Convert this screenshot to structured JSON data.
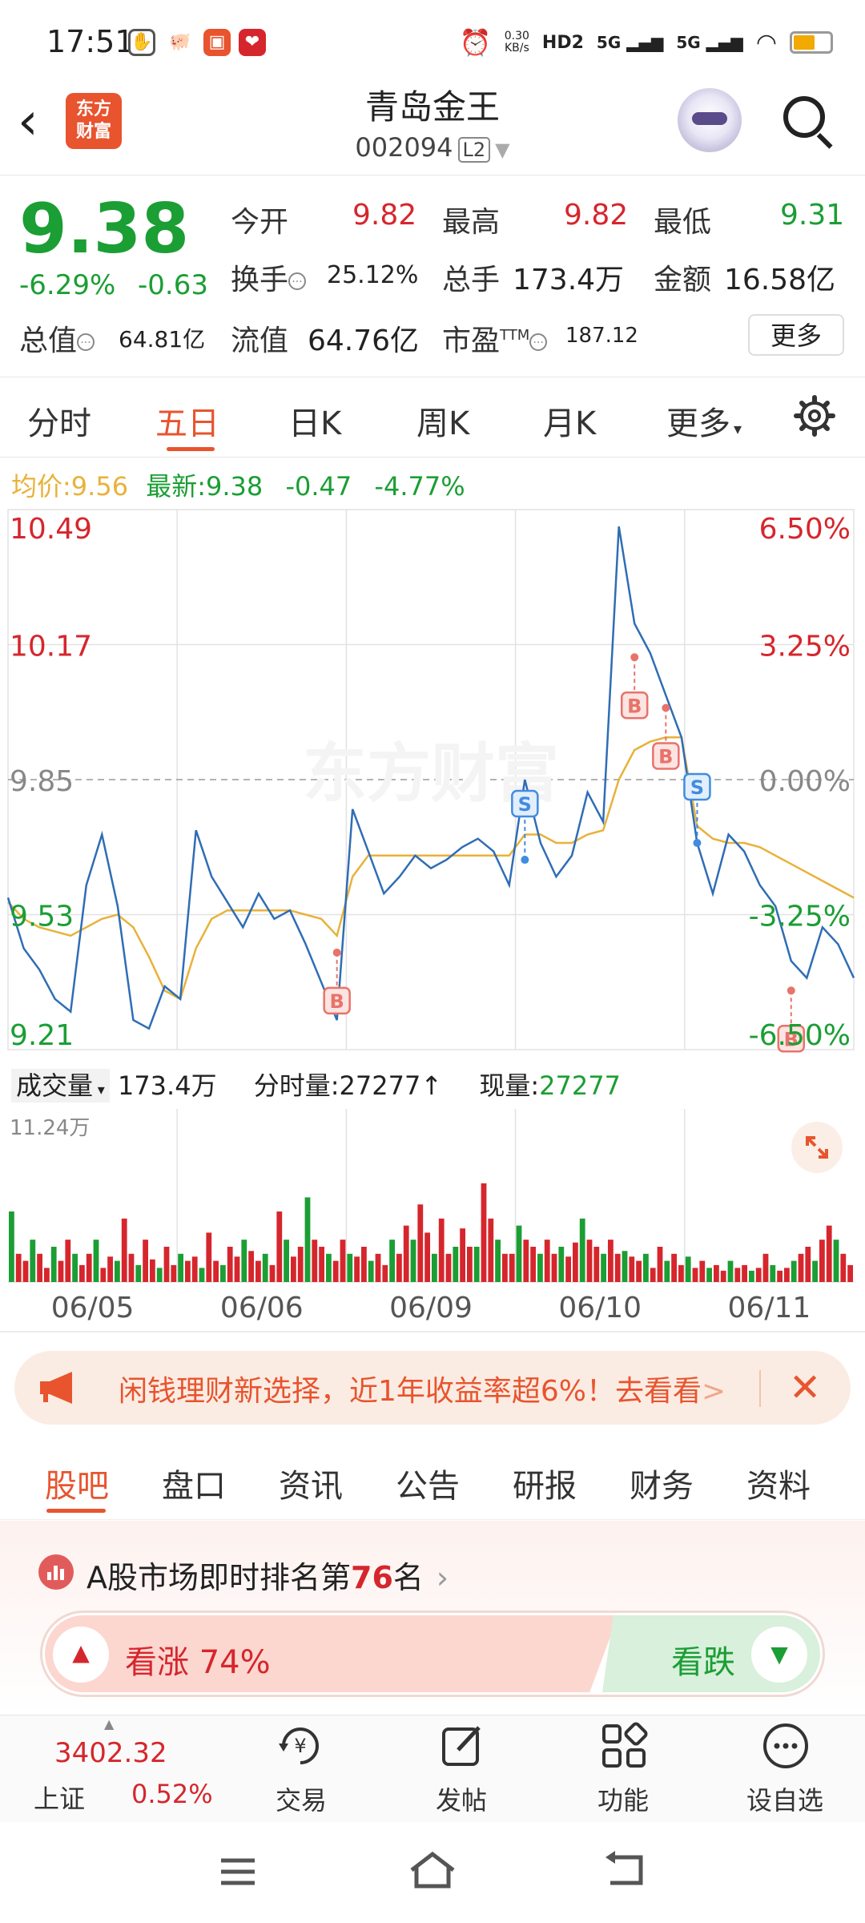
{
  "status_bar": {
    "time": "17:51",
    "net_speed": "0.30\nKB/s",
    "signal_labels": [
      "HD2",
      "5G",
      "5G"
    ],
    "battery_level": 0.6
  },
  "header": {
    "logo_text": "东方财富",
    "stock_name": "青岛金王",
    "stock_code": "002094",
    "level_badge": "L2"
  },
  "quote": {
    "price": "9.38",
    "change_pct": "-6.29%",
    "change": "-0.63",
    "open_label": "今开",
    "open": "9.82",
    "high_label": "最高",
    "high": "9.82",
    "low_label": "最低",
    "low": "9.31",
    "turnover_label": "换手",
    "turnover": "25.12%",
    "volume_label": "总手",
    "volume": "173.4万",
    "amount_label": "金额",
    "amount": "16.58亿",
    "mktcap_label": "总值",
    "mktcap": "64.81亿",
    "float_label": "流值",
    "float": "64.76亿",
    "pe_label": "市盈",
    "pe_sup": "TTM",
    "pe": "187.12",
    "more_button": "更多"
  },
  "chart_tabs": [
    "分时",
    "五日",
    "日K",
    "周K",
    "月K",
    "更多"
  ],
  "active_tab": "五日",
  "info_line": {
    "avg_label": "均价:",
    "avg": "9.56",
    "latest_label": "最新:",
    "latest": "9.38",
    "chg": "-0.47",
    "chg_pct": "-4.77%"
  },
  "colors": {
    "up": "#d6262d",
    "down": "#1b9e34",
    "accent": "#e8542e",
    "price_line": "#2f6db5",
    "avg_line": "#e8b23a"
  },
  "chart_data": {
    "type": "line",
    "title": "",
    "ylabels_left": [
      "10.49",
      "10.17",
      "9.85",
      "9.53",
      "9.21"
    ],
    "ylabels_right": [
      "6.50%",
      "3.25%",
      "0.00%",
      "-3.25%",
      "-6.50%"
    ],
    "ylim": [
      9.21,
      10.49
    ],
    "reference_price": 9.85,
    "x_labels": [
      "06/05",
      "06/06",
      "06/09",
      "06/10",
      "06/11"
    ],
    "series": [
      {
        "role": "price",
        "values": [
          9.57,
          9.45,
          9.4,
          9.33,
          9.3,
          9.6,
          9.72,
          9.55,
          9.28,
          9.26,
          9.36,
          9.33,
          9.73,
          9.62,
          9.56,
          9.5,
          9.58,
          9.52,
          9.54,
          9.46,
          9.37,
          9.28,
          9.78,
          9.68,
          9.58,
          9.62,
          9.67,
          9.64,
          9.66,
          9.69,
          9.71,
          9.68,
          9.6,
          9.85,
          9.7,
          9.62,
          9.67,
          9.82,
          9.75,
          10.45,
          10.22,
          10.15,
          10.05,
          9.95,
          9.7,
          9.58,
          9.72,
          9.68,
          9.6,
          9.55,
          9.42,
          9.38,
          9.5,
          9.46,
          9.38
        ]
      },
      {
        "role": "average",
        "values": [
          9.56,
          9.52,
          9.5,
          9.49,
          9.48,
          9.5,
          9.52,
          9.53,
          9.5,
          9.43,
          9.35,
          9.33,
          9.45,
          9.52,
          9.54,
          9.54,
          9.54,
          9.54,
          9.54,
          9.53,
          9.52,
          9.48,
          9.62,
          9.67,
          9.67,
          9.67,
          9.67,
          9.67,
          9.67,
          9.67,
          9.67,
          9.67,
          9.67,
          9.72,
          9.72,
          9.7,
          9.7,
          9.72,
          9.73,
          9.85,
          9.92,
          9.94,
          9.95,
          9.95,
          9.74,
          9.71,
          9.7,
          9.7,
          9.69,
          9.67,
          9.65,
          9.63,
          9.61,
          9.59,
          9.57
        ]
      }
    ],
    "signals": [
      {
        "label": "B",
        "value": 9.44,
        "kind": "buy",
        "idx": 21
      },
      {
        "label": "S",
        "value": 9.66,
        "kind": "sell",
        "idx": 33
      },
      {
        "label": "B",
        "value": 10.14,
        "kind": "buy",
        "idx": 40
      },
      {
        "label": "S",
        "value": 9.7,
        "kind": "sell",
        "idx": 44
      },
      {
        "label": "B",
        "value": 10.02,
        "kind": "buy",
        "idx": 42
      },
      {
        "label": "B",
        "value": 9.35,
        "kind": "buy",
        "idx": 50
      }
    ],
    "volume": {
      "label": "成交量",
      "total": "173.4万",
      "tick_label": "分时量:",
      "tick": "27277",
      "now_label": "现量:",
      "now": "27277",
      "max_label": "11.24万",
      "bars": [
        0.5,
        0.2,
        0.15,
        0.3,
        0.2,
        0.1,
        0.25,
        0.15,
        0.3,
        0.2,
        0.12,
        0.2,
        0.3,
        0.1,
        0.18,
        0.15,
        0.45,
        0.2,
        0.12,
        0.3,
        0.16,
        0.1,
        0.25,
        0.12,
        0.2,
        0.15,
        0.18,
        0.1,
        0.35,
        0.15,
        0.12,
        0.25,
        0.18,
        0.3,
        0.22,
        0.15,
        0.2,
        0.12,
        0.5,
        0.3,
        0.18,
        0.25,
        0.6,
        0.3,
        0.25,
        0.2,
        0.15,
        0.3,
        0.2,
        0.18,
        0.25,
        0.15,
        0.2,
        0.12,
        0.3,
        0.2,
        0.4,
        0.3,
        0.55,
        0.35,
        0.2,
        0.45,
        0.2,
        0.25,
        0.38,
        0.25,
        0.25,
        0.7,
        0.45,
        0.3,
        0.2,
        0.2,
        0.4,
        0.3,
        0.25,
        0.2,
        0.3,
        0.2,
        0.25,
        0.18,
        0.28,
        0.45,
        0.3,
        0.25,
        0.2,
        0.3,
        0.2,
        0.22,
        0.18,
        0.15,
        0.2,
        0.1,
        0.25,
        0.15,
        0.2,
        0.12,
        0.18,
        0.1,
        0.15,
        0.1,
        0.12,
        0.08,
        0.15,
        0.1,
        0.12,
        0.08,
        0.1,
        0.2,
        0.12,
        0.08,
        0.1,
        0.15,
        0.2,
        0.25,
        0.15,
        0.3,
        0.4,
        0.3,
        0.2,
        0.12
      ]
    }
  },
  "banner": {
    "text": "闲钱理财新选择，近1年收益率超6%！去看看",
    "arrow": ">",
    "close": "✕"
  },
  "sub_tabs": [
    "股吧",
    "盘口",
    "资讯",
    "公告",
    "研报",
    "财务",
    "资料"
  ],
  "rank": {
    "prefix": "A股市场即时排名第",
    "number": "76",
    "suffix": "名",
    "chevron": "›"
  },
  "vote": {
    "up_label": "看涨 74%",
    "down_label": "看跌",
    "up_share": 0.74
  },
  "bottom_bar": {
    "index_value": "3402.32",
    "index_name": "上证",
    "index_chg": "0.52%",
    "items": [
      "交易",
      "发帖",
      "功能",
      "设自选"
    ]
  }
}
